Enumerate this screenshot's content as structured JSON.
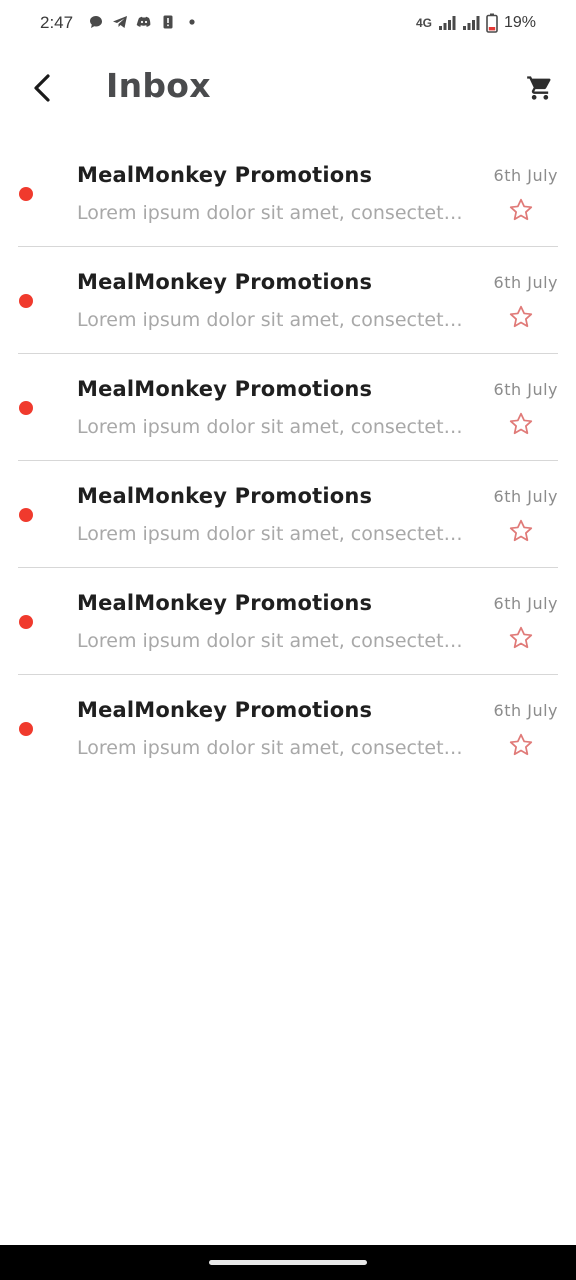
{
  "status_bar": {
    "time": "2:47",
    "network": "4G",
    "battery": "19%"
  },
  "header": {
    "title": "Inbox"
  },
  "icons": {
    "back": "chevron-left-icon",
    "cart": "shopping-cart-icon",
    "star": "star-outline-icon"
  },
  "colors": {
    "accent": "#f03a2d",
    "star": "#e07a78"
  },
  "messages": [
    {
      "title": "MealMonkey Promotions",
      "preview": "Lorem ipsum dolor sit amet, consectetur adipiscing elit",
      "date": "6th July",
      "unread": true
    },
    {
      "title": "MealMonkey Promotions",
      "preview": "Lorem ipsum dolor sit amet, consectetur adipiscing elit",
      "date": "6th July",
      "unread": true
    },
    {
      "title": "MealMonkey Promotions",
      "preview": "Lorem ipsum dolor sit amet, consectetur adipiscing elit",
      "date": "6th July",
      "unread": true
    },
    {
      "title": "MealMonkey Promotions",
      "preview": "Lorem ipsum dolor sit amet, consectetur adipiscing elit",
      "date": "6th July",
      "unread": true
    },
    {
      "title": "MealMonkey Promotions",
      "preview": "Lorem ipsum dolor sit amet, consectetur adipiscing elit",
      "date": "6th July",
      "unread": true
    },
    {
      "title": "MealMonkey Promotions",
      "preview": "Lorem ipsum dolor sit amet, consectetur adipiscing elit",
      "date": "6th July",
      "unread": true
    }
  ]
}
